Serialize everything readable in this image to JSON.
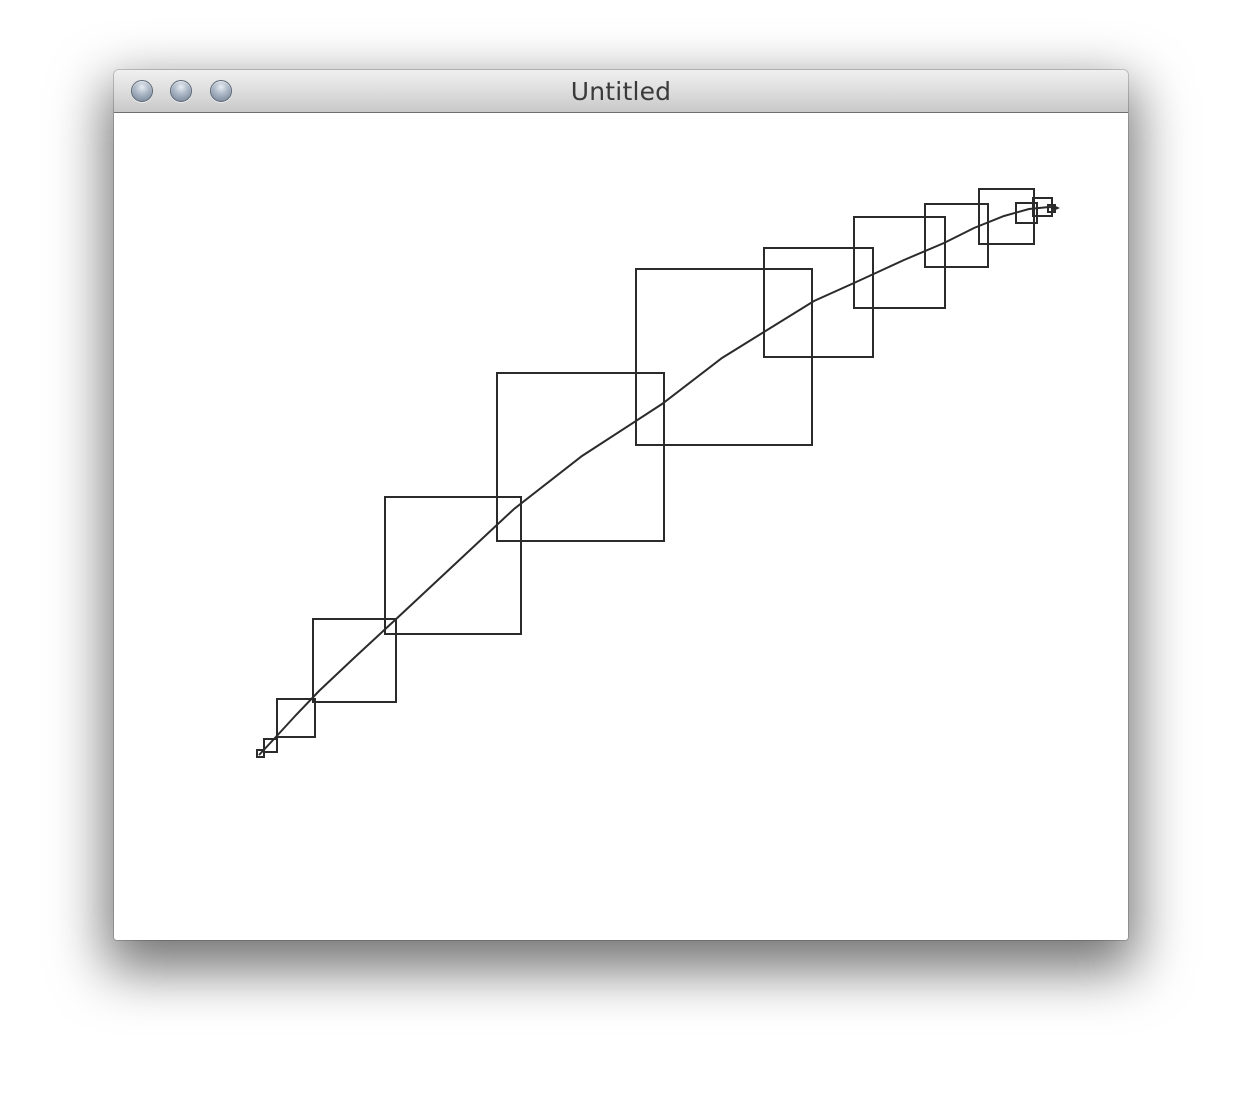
{
  "window": {
    "title": "Untitled",
    "buttons": {
      "close_icon": "circle-button",
      "minimize_icon": "circle-button",
      "zoom_icon": "circle-button"
    }
  },
  "drawing": {
    "stroke_color": "#2b2b2b",
    "background_color": "#ffffff",
    "shapes": "squares-along-curve"
  }
}
